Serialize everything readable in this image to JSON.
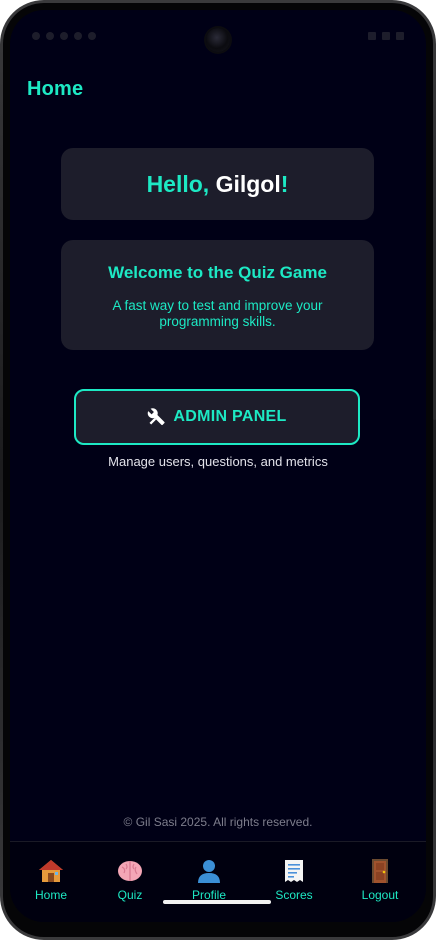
{
  "header": {
    "title": "Home"
  },
  "greeting": {
    "hello": "Hello,",
    "name": "Gilgol",
    "exclaim": "!"
  },
  "welcome": {
    "title": "Welcome to the Quiz Game",
    "subtitle": "A fast way to test and improve your programming skills."
  },
  "admin": {
    "button_label": "ADMIN PANEL",
    "icon": "tools-icon",
    "caption": "Manage users, questions, and metrics"
  },
  "footer": {
    "copyright": "© Gil Sasi 2025. All rights reserved."
  },
  "nav": {
    "items": [
      {
        "label": "Home",
        "icon": "house-icon"
      },
      {
        "label": "Quiz",
        "icon": "brain-icon"
      },
      {
        "label": "Profile",
        "icon": "person-icon"
      },
      {
        "label": "Scores",
        "icon": "receipt-icon"
      },
      {
        "label": "Logout",
        "icon": "door-icon"
      }
    ]
  },
  "colors": {
    "accent": "#1de9c4",
    "background": "#000016",
    "card": "#1d1d2b",
    "text_light": "#ffffff"
  }
}
